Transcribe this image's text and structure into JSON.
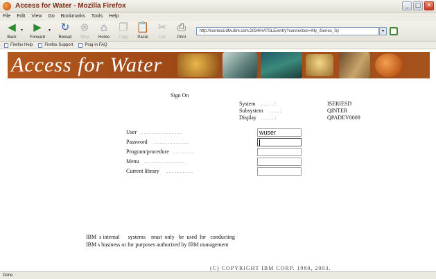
{
  "window": {
    "title": "Access for Water - Mozilla Firefox",
    "controls": [
      "_",
      "□",
      "×"
    ]
  },
  "menu": [
    "File",
    "Edit",
    "View",
    "Go",
    "Bookmarks",
    "Tools",
    "Help"
  ],
  "toolbar": {
    "back": "Back",
    "forward": "Forward",
    "reload": "Reload",
    "stop": "Stop",
    "home": "Home",
    "copy": "Copy",
    "paste": "Paste",
    "cut": "Cut",
    "print": "Print",
    "url": "http://iseriesd.dfw.ibm.com:2034/HATSLE/entry?connection=My_iSeries_Sy"
  },
  "bookmarks": [
    "Firefox Help",
    "Firefox Support",
    "Plug-in FAQ"
  ],
  "banner": {
    "title": "Access for Water"
  },
  "signon": {
    "heading": "Sign On",
    "system_label": "System",
    "system_value": "ISERIESD",
    "subsystem_label": "Subsystem",
    "subsystem_value": "QINTER",
    "display_label": "Display",
    "display_value": "QPADEV0009",
    "leader_sys": ". . . . . :",
    "leader_sub": ". . . . :",
    "leader_disp": ". . . . . :"
  },
  "form": {
    "user_label": "User",
    "user_dots": ". . . . . . . . . . . . . . .",
    "user_value": "wuser",
    "password_label": "Password",
    "password_dots": ". . . . . . . . . . . . .",
    "program_label": "Program/procedure",
    "program_dots": ". . . . . . . .",
    "menu_label": "Menu",
    "menu_dots": ". . . . . . . . . . . . . . .",
    "library_label": "Current library",
    "library_dots": ". . . . . . . . . ."
  },
  "notice": {
    "line1": "IBM  s internal      systems    must  only   be  used  for   conducting",
    "line2": "IBM  s business or for purposes authorized by IBM management"
  },
  "copyright": "(C) COPYRIGHT IBM CORP. 1980, 2003.",
  "status": "Done"
}
